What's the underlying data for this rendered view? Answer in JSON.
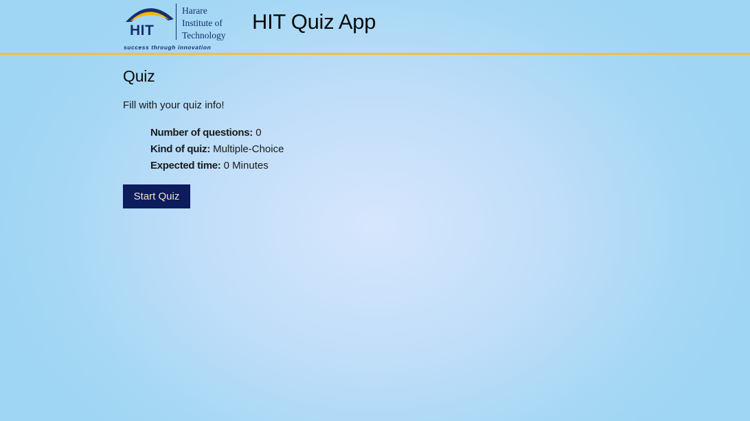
{
  "header": {
    "app_title": "HIT Quiz App",
    "logo": {
      "acronym": "HIT",
      "name_line1": "Harare",
      "name_line2": "Institute of",
      "name_line3": "Technology",
      "tagline": "success through innovation"
    }
  },
  "main": {
    "heading": "Quiz",
    "subtitle": "Fill with your quiz info!",
    "info": [
      {
        "label": "Number of questions:",
        "value": "0"
      },
      {
        "label": "Kind of quiz:",
        "value": "Multiple-Choice"
      },
      {
        "label": "Expected time:",
        "value": "0 Minutes"
      }
    ],
    "start_button": "Start Quiz"
  },
  "colors": {
    "accent_border": "#f1c232",
    "button_bg": "#0c1c5c",
    "button_text": "#f5e3c8",
    "logo_navy": "#14306e",
    "logo_yellow": "#f5b800"
  }
}
